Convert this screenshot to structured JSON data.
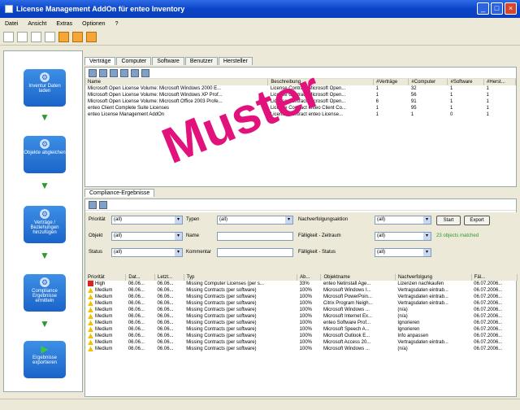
{
  "window": {
    "title": "License Management AddOn für enteo Inventory"
  },
  "menu": [
    "Datei",
    "Ansicht",
    "Extras",
    "Optionen",
    "?"
  ],
  "workflow": [
    {
      "label": "Inventur Daten laden"
    },
    {
      "label": "Objekte abgleichen"
    },
    {
      "label": "Verträge / Beziehungen hinzufügen"
    },
    {
      "label": "Compliance Ergebnisse ermitteln"
    },
    {
      "label": "Ergebnisse exportieren"
    }
  ],
  "top_tabs": [
    "Verträge",
    "Computer",
    "Software",
    "Benutzer",
    "Hersteller"
  ],
  "top_grid": {
    "columns": [
      "Name",
      "Beschreibung",
      "#Verträge",
      "#Computer",
      "#Software",
      "#Herst..."
    ],
    "rows": [
      [
        "Microsoft Open License Volume: Microsoft Windows 2000 E...",
        "License Contract Microsoft Open...",
        "1",
        "32",
        "1",
        "1"
      ],
      [
        "Microsoft Open License Volume: Microsoft Windows XP Prof...",
        "License Contract Microsoft Open...",
        "1",
        "56",
        "1",
        "1"
      ],
      [
        "Microsoft Open License Volume: Microsoft Office 2003 Profe...",
        "License Contract Microsoft Open...",
        "6",
        "91",
        "1",
        "1"
      ],
      [
        "enteo Client Complete Suite Licenses",
        "License Contract enteo Client Co...",
        "1",
        "95",
        "1",
        "1"
      ],
      [
        "enteo License Management AddOn",
        "License Contract enteo License...",
        "1",
        "1",
        "0",
        "1"
      ]
    ]
  },
  "bottom_tabs": [
    "Compliance-Ergebnisse"
  ],
  "filters": {
    "prioritaet": {
      "label": "Priorität",
      "value": "(all)"
    },
    "typen": {
      "label": "Typen",
      "value": "(all)"
    },
    "nachverfolgungsaktion": {
      "label": "Nachverfolgungsaktion",
      "value": "(all)"
    },
    "objekt": {
      "label": "Objekt",
      "value": "(all)"
    },
    "name": {
      "label": "Name",
      "value": ""
    },
    "faelligkeit_zeitraum": {
      "label": "Fälligkeit - Zeitraum",
      "value": "(all)"
    },
    "status": {
      "label": "Status",
      "value": "(all)"
    },
    "kommentar": {
      "label": "Kommentar",
      "value": ""
    },
    "faelligkeit_status": {
      "label": "Fälligkeit - Status",
      "value": "(all)"
    },
    "start_label": "Start",
    "export_label": "Export",
    "hint": "23 objects matched"
  },
  "results": {
    "columns": [
      "Priorität",
      "Dat...",
      "Letzt...",
      "Typ",
      "Ab...",
      "Objektname",
      "Nachverfolgung",
      "Fäl..."
    ],
    "rows": [
      [
        "High",
        "06.06...",
        "06.06...",
        "Missing Computer Licenses (per s...",
        "33%",
        "enteo Netinstall Age...",
        "Lizenzen nachkaufen",
        "06.07.2006..."
      ],
      [
        "Medium",
        "06.06...",
        "06.06...",
        "Missing Contracts (per software)",
        "100%",
        "Microsoft Windows I...",
        "Vertragsdaten eintrab...",
        "06.07.2006..."
      ],
      [
        "Medium",
        "06.06...",
        "06.06...",
        "Missing Contracts (per software)",
        "100%",
        "Microsoft PowerPoin...",
        "Vertragsdaten eintrab...",
        "06.07.2006..."
      ],
      [
        "Medium",
        "06.06...",
        "06.06...",
        "Missing Contracts (per software)",
        "100%",
        "Citrix Program Neigh...",
        "Vertragsdaten eintrab...",
        "06.07.2006..."
      ],
      [
        "Medium",
        "06.06...",
        "06.06...",
        "Missing Contracts (per software)",
        "100%",
        "Microsoft Windows ...",
        "(n/a)",
        "06.07.2006..."
      ],
      [
        "Medium",
        "06.06...",
        "06.06...",
        "Missing Contracts (per software)",
        "100%",
        "Microsoft Internet Ex...",
        "(n/a)",
        "06.07.2006..."
      ],
      [
        "Medium",
        "06.06...",
        "06.06...",
        "Missing Contracts (per software)",
        "100%",
        "enteo Software Prof...",
        "Ignorieren",
        "06.07.2006..."
      ],
      [
        "Medium",
        "06.06...",
        "06.06...",
        "Missing Contracts (per software)",
        "100%",
        "Microsoft Speech A...",
        "Ignorieren",
        "06.07.2006..."
      ],
      [
        "Medium",
        "06.06...",
        "06.06...",
        "Missing Contracts (per software)",
        "100%",
        "Microsoft Outlook E...",
        "Info anpassen",
        "06.07.2006..."
      ],
      [
        "Medium",
        "06.06...",
        "06.06...",
        "Missing Contracts (per software)",
        "100%",
        "Microsoft Access 20...",
        "Vertragsdaten eintrab...",
        "06.07.2006..."
      ],
      [
        "Medium",
        "06.06...",
        "06.06...",
        "Missing Contracts (per software)",
        "100%",
        "Microsoft Windows ...",
        "(n/a)",
        "06.07.2006..."
      ]
    ]
  },
  "watermark": "Muster",
  "colors": {
    "watermark": "#E2127D",
    "title_bar": "#0A45C8",
    "flow_button": "#1A64C9"
  }
}
